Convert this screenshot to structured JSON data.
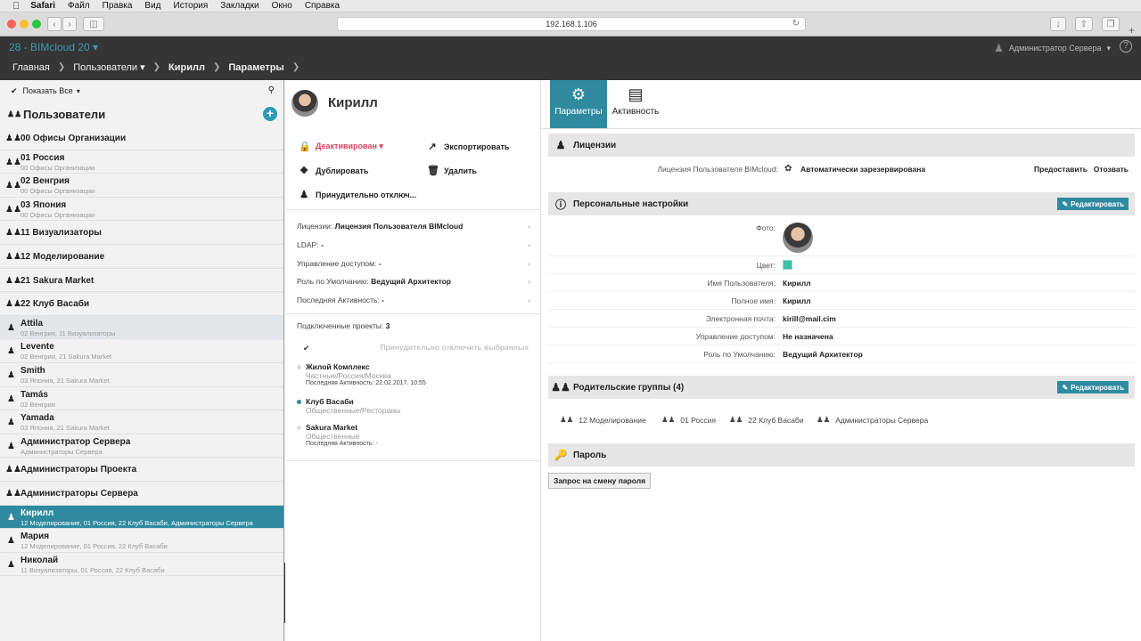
{
  "macos": {
    "menu": [
      "Safari",
      "Файл",
      "Правка",
      "Вид",
      "История",
      "Закладки",
      "Окно",
      "Справка"
    ]
  },
  "safari": {
    "url": "192.168.1.106"
  },
  "header": {
    "brand": "28 - BIMcloud 20 ▾",
    "user": "Администратор Сервера",
    "breadcrumb": [
      "Главная",
      "Пользователи ▾",
      "Кирилл",
      "Параметры"
    ]
  },
  "left": {
    "show_all": "Показать Все",
    "title": "Пользователи",
    "rows": [
      {
        "t": "00 Офисы Организации",
        "s": "",
        "type": "group"
      },
      {
        "t": "01 Россия",
        "s": "00 Офисы Организации",
        "type": "group"
      },
      {
        "t": "02 Венгрия",
        "s": "00 Офисы Организации",
        "type": "group"
      },
      {
        "t": "03 Япония",
        "s": "00 Офисы Организации",
        "type": "group"
      },
      {
        "t": "11 Визуализаторы",
        "s": "",
        "type": "group"
      },
      {
        "t": "12 Моделирование",
        "s": "",
        "type": "group"
      },
      {
        "t": "21 Sakura Market",
        "s": "",
        "type": "group"
      },
      {
        "t": "22 Клуб Васаби",
        "s": "",
        "type": "group"
      },
      {
        "t": "Attila",
        "s": "02 Венгрия, 11 Визуализаторы",
        "type": "user"
      },
      {
        "t": "Levente",
        "s": "02 Венгрия, 21 Sakura Market",
        "type": "user"
      },
      {
        "t": "Smith",
        "s": "03 Япония, 21 Sakura Market",
        "type": "user"
      },
      {
        "t": "Tamás",
        "s": "02 Венгрия",
        "type": "user"
      },
      {
        "t": "Yamada",
        "s": "03 Япония, 21 Sakura Market",
        "type": "user"
      },
      {
        "t": "Администратор Сервера",
        "s": "Администраторы Сервера",
        "type": "user"
      },
      {
        "t": "Администраторы Проекта",
        "s": "",
        "type": "group"
      },
      {
        "t": "Администраторы Сервера",
        "s": "",
        "type": "group"
      },
      {
        "t": "Кирилл",
        "s": "12 Моделирование, 01 Россия, 22 Клуб Васаби, Администраторы Сервера",
        "type": "user"
      },
      {
        "t": "Мария",
        "s": "12 Моделирование, 01 Россия, 22 Клуб Васаби",
        "type": "user"
      },
      {
        "t": "Николай",
        "s": "11 Визуализаторы, 01 Россия, 22 Клуб Васаби",
        "type": "user"
      }
    ]
  },
  "mid": {
    "name": "Кирилл",
    "actions": {
      "deactivated": "Деактивирован ▾",
      "export": "Экспортировать",
      "duplicate": "Дублировать",
      "delete": "Удалить",
      "force_disconnect": "Принудительно отключ..."
    },
    "info": [
      {
        "k": "Лицензии:",
        "v": "Лицензия Пользователя BIMcloud"
      },
      {
        "k": "LDAP:",
        "v": "-"
      },
      {
        "k": "Управление доступом:",
        "v": "-"
      },
      {
        "k": "Роль по Умолчанию:",
        "v": "Ведущий Архитектор"
      },
      {
        "k": "Последняя Активность:",
        "v": "-"
      }
    ],
    "projects_label": "Подключенные проекты:",
    "projects_count": "3",
    "force_selected": "Принудительно отключить выбранных",
    "projects": [
      {
        "n": "Жилой Комплекс",
        "p": "Частные/Россия/Москва",
        "a": "Последняя Активность: 22.02.2017. 10:55"
      },
      {
        "n": "Клуб Васаби",
        "p": "Общественные/Рестораны",
        "a": ""
      },
      {
        "n": "Sakura Market",
        "p": "Общественные",
        "a": "Последняя Активность: -"
      }
    ]
  },
  "right": {
    "tabs": [
      "Параметры",
      "Активность"
    ],
    "licenses": {
      "title": "Лицензии",
      "label": "Лицензия Пользователя BIMcloud:",
      "value": "Автоматически зарезервирована",
      "grant": "Предоставить",
      "revoke": "Отозвать"
    },
    "personal": {
      "title": "Персональные настройки",
      "edit": "Редактировать",
      "photo": "Фото:",
      "color": "Цвет:",
      "color_value": "#3bbfa8",
      "fields": [
        {
          "k": "Имя Пользователя:",
          "v": "Кирилл"
        },
        {
          "k": "Полное имя:",
          "v": "Кирилл"
        },
        {
          "k": "Электронная почта:",
          "v": "kirill@mail.cim"
        },
        {
          "k": "Управление доступом:",
          "v": "Не назначена"
        },
        {
          "k": "Роль по Умолчанию:",
          "v": "Ведущий Архитектор"
        }
      ]
    },
    "groups": {
      "title": "Родительские группы (4)",
      "edit": "Редактировать",
      "items": [
        "12 Моделирование",
        "01 Россия",
        "22 Клуб Васаби",
        "Администраторы Сервера"
      ]
    },
    "password": {
      "title": "Пароль",
      "button": "Запрос на смену пароля"
    }
  }
}
